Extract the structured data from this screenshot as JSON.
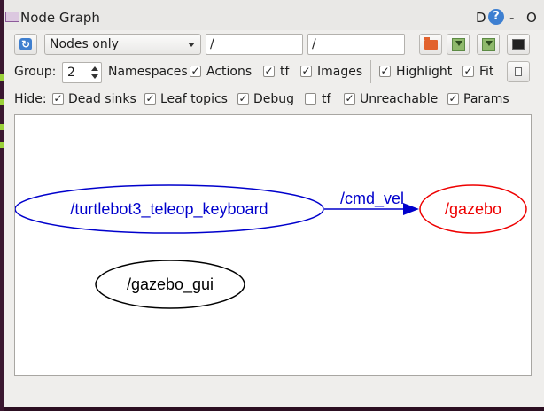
{
  "window": {
    "title": "Node Graph",
    "title_d": "D",
    "help_glyph": "?",
    "title_dash": "-",
    "title_o": "O"
  },
  "toolbar": {
    "refresh_icon": "refresh-icon",
    "graph_mode": "Nodes only",
    "node_filter": "/",
    "topic_filter": "/"
  },
  "group_row": {
    "group_label": "Group:",
    "group_value": "2",
    "namespaces_label": "Namespaces",
    "namespaces_checked": true,
    "actions_label": "Actions",
    "actions_checked": true,
    "tf_label": "tf",
    "tf_checked": true,
    "images_label": "Images",
    "images_checked": true,
    "highlight_label": "Highlight",
    "highlight_checked": true,
    "fit_label": "Fit",
    "fit_checked": true
  },
  "hide_row": {
    "hide_label": "Hide:",
    "dead_sinks_label": "Dead sinks",
    "dead_sinks_checked": true,
    "leaf_topics_label": "Leaf topics",
    "leaf_topics_checked": true,
    "debug_label": "Debug",
    "debug_checked": true,
    "tf_label": "tf",
    "tf_checked": false,
    "unreachable_label": "Unreachable",
    "unreachable_checked": true,
    "params_label": "Params",
    "params_checked": true
  },
  "check_glyph": "✓",
  "graph": {
    "nodes": [
      {
        "label": "/turtlebot3_teleop_keyboard",
        "color": "#0000cc"
      },
      {
        "label": "/gazebo",
        "color": "#ee0000"
      },
      {
        "label": "/gazebo_gui",
        "color": "#000000"
      }
    ],
    "edges": [
      {
        "from": "/turtlebot3_teleop_keyboard",
        "to": "/gazebo",
        "label": "/cmd_vel",
        "color": "#0000cc"
      }
    ]
  },
  "colors": {
    "accent": "#3d7fd1",
    "terminal_bg": "#2c0f22",
    "terminal_text": "#9bd13a"
  }
}
